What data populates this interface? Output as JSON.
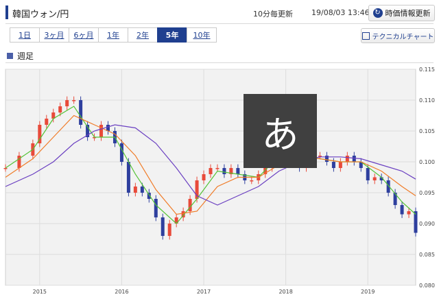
{
  "header": {
    "title": "韓国ウォン/円",
    "update_frequency": "10分毎更新",
    "timestamp": "19/08/03 13:46",
    "refresh_label": "時価情報更新"
  },
  "tabs": [
    {
      "label": "1日",
      "active": false
    },
    {
      "label": "3ヶ月",
      "active": false
    },
    {
      "label": "6ヶ月",
      "active": false
    },
    {
      "label": "1年",
      "active": false
    },
    {
      "label": "2年",
      "active": false
    },
    {
      "label": "5年",
      "active": true
    },
    {
      "label": "10年",
      "active": false
    }
  ],
  "technical_chart_label": "テクニカルチャート",
  "period_label": "週足",
  "overlay_char": "あ",
  "colors": {
    "accent": "#1f3f8f",
    "candle_up": "#e84a3a",
    "candle_down": "#2e3f9e",
    "ma_short": "#52c234",
    "ma_mid": "#f07c28",
    "ma_long": "#6a3fc1",
    "plot_bg": "#f2f2f2"
  },
  "chart_data": {
    "type": "candlestick",
    "title": "",
    "xlabel": "",
    "ylabel": "",
    "ylim": [
      0.08,
      0.115
    ],
    "yticks": [
      "0.115",
      "0.110",
      "0.105",
      "0.100",
      "0.095",
      "0.090",
      "0.085",
      "0.080"
    ],
    "xticks": [
      "2015",
      "2016",
      "2017",
      "2018",
      "2019"
    ],
    "xrange": [
      "2014-08",
      "2019-08"
    ],
    "grid": true,
    "series": [
      {
        "type": "candlestick",
        "points": [
          [
            "2014-08",
            0.099
          ],
          [
            "2014-10",
            0.101
          ],
          [
            "2014-12",
            0.103
          ],
          [
            "2015-01",
            0.106
          ],
          [
            "2015-02",
            0.107
          ],
          [
            "2015-03",
            0.108
          ],
          [
            "2015-04",
            0.109
          ],
          [
            "2015-05",
            0.11
          ],
          [
            "2015-06",
            0.11
          ],
          [
            "2015-07",
            0.106
          ],
          [
            "2015-08",
            0.104
          ],
          [
            "2015-09",
            0.104
          ],
          [
            "2015-10",
            0.106
          ],
          [
            "2015-11",
            0.105
          ],
          [
            "2015-12",
            0.103
          ],
          [
            "2016-01",
            0.1
          ],
          [
            "2016-02",
            0.095
          ],
          [
            "2016-03",
            0.096
          ],
          [
            "2016-04",
            0.095
          ],
          [
            "2016-05",
            0.094
          ],
          [
            "2016-06",
            0.091
          ],
          [
            "2016-07",
            0.088
          ],
          [
            "2016-08",
            0.09
          ],
          [
            "2016-09",
            0.091
          ],
          [
            "2016-10",
            0.092
          ],
          [
            "2016-11",
            0.094
          ],
          [
            "2016-12",
            0.097
          ],
          [
            "2017-01",
            0.098
          ],
          [
            "2017-02",
            0.099
          ],
          [
            "2017-03",
            0.099
          ],
          [
            "2017-04",
            0.098
          ],
          [
            "2017-05",
            0.099
          ],
          [
            "2017-06",
            0.098
          ],
          [
            "2017-07",
            0.097
          ],
          [
            "2017-08",
            0.097
          ],
          [
            "2017-09",
            0.098
          ],
          [
            "2017-10",
            0.099
          ],
          [
            "2017-11",
            0.102
          ],
          [
            "2017-12",
            0.102
          ],
          [
            "2018-01",
            0.103
          ],
          [
            "2018-02",
            0.102
          ],
          [
            "2018-03",
            0.099
          ],
          [
            "2018-04",
            0.1
          ],
          [
            "2018-05",
            0.101
          ],
          [
            "2018-06",
            0.101
          ],
          [
            "2018-07",
            0.1
          ],
          [
            "2018-08",
            0.099
          ],
          [
            "2018-09",
            0.1
          ],
          [
            "2018-10",
            0.101
          ],
          [
            "2018-11",
            0.1
          ],
          [
            "2018-12",
            0.099
          ],
          [
            "2019-01",
            0.097
          ],
          [
            "2019-02",
            0.0975
          ],
          [
            "2019-03",
            0.097
          ],
          [
            "2019-04",
            0.095
          ],
          [
            "2019-05",
            0.093
          ],
          [
            "2019-06",
            0.0915
          ],
          [
            "2019-07",
            0.092
          ],
          [
            "2019-08",
            0.0885
          ]
        ]
      },
      {
        "type": "line",
        "points": [
          [
            "2014-08",
            0.099
          ],
          [
            "2014-12",
            0.102
          ],
          [
            "2015-03",
            0.107
          ],
          [
            "2015-06",
            0.109
          ],
          [
            "2015-09",
            0.104
          ],
          [
            "2015-12",
            0.104
          ],
          [
            "2016-03",
            0.098
          ],
          [
            "2016-06",
            0.093
          ],
          [
            "2016-09",
            0.09
          ],
          [
            "2016-12",
            0.094
          ],
          [
            "2017-03",
            0.0985
          ],
          [
            "2017-06",
            0.098
          ],
          [
            "2017-09",
            0.0975
          ],
          [
            "2017-12",
            0.101
          ],
          [
            "2018-03",
            0.101
          ],
          [
            "2018-06",
            0.1005
          ],
          [
            "2018-09",
            0.1
          ],
          [
            "2018-12",
            0.1
          ],
          [
            "2019-03",
            0.0975
          ],
          [
            "2019-06",
            0.0935
          ],
          [
            "2019-08",
            0.0915
          ]
        ]
      },
      {
        "type": "line",
        "points": [
          [
            "2014-08",
            0.0975
          ],
          [
            "2014-12",
            0.1005
          ],
          [
            "2015-03",
            0.104
          ],
          [
            "2015-06",
            0.1075
          ],
          [
            "2015-09",
            0.106
          ],
          [
            "2015-12",
            0.1045
          ],
          [
            "2016-03",
            0.101
          ],
          [
            "2016-06",
            0.0955
          ],
          [
            "2016-09",
            0.0915
          ],
          [
            "2016-12",
            0.092
          ],
          [
            "2017-03",
            0.096
          ],
          [
            "2017-06",
            0.0975
          ],
          [
            "2017-09",
            0.0975
          ],
          [
            "2017-12",
            0.0995
          ],
          [
            "2018-03",
            0.101
          ],
          [
            "2018-06",
            0.1005
          ],
          [
            "2018-09",
            0.1
          ],
          [
            "2018-12",
            0.1
          ],
          [
            "2019-03",
            0.0985
          ],
          [
            "2019-06",
            0.096
          ],
          [
            "2019-08",
            0.0945
          ]
        ]
      },
      {
        "type": "line",
        "points": [
          [
            "2014-08",
            0.096
          ],
          [
            "2014-12",
            0.098
          ],
          [
            "2015-03",
            0.1
          ],
          [
            "2015-06",
            0.103
          ],
          [
            "2015-09",
            0.105
          ],
          [
            "2015-12",
            0.106
          ],
          [
            "2016-03",
            0.1055
          ],
          [
            "2016-06",
            0.103
          ],
          [
            "2016-09",
            0.099
          ],
          [
            "2016-12",
            0.0945
          ],
          [
            "2017-03",
            0.093
          ],
          [
            "2017-06",
            0.0945
          ],
          [
            "2017-09",
            0.096
          ],
          [
            "2017-12",
            0.0985
          ],
          [
            "2018-03",
            0.1
          ],
          [
            "2018-06",
            0.1008
          ],
          [
            "2018-09",
            0.1008
          ],
          [
            "2018-12",
            0.1005
          ],
          [
            "2019-03",
            0.0995
          ],
          [
            "2019-06",
            0.0985
          ],
          [
            "2019-08",
            0.0972
          ]
        ]
      }
    ]
  }
}
